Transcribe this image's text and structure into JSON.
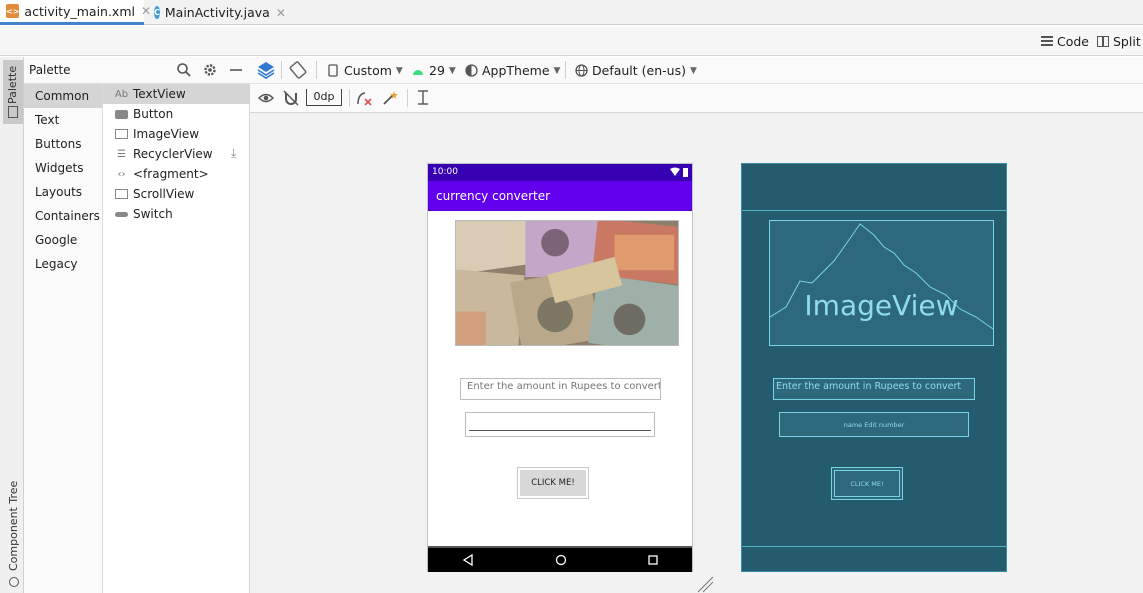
{
  "tabs": [
    {
      "label": "activity_main.xml",
      "active": true,
      "icon": "xml-file-icon"
    },
    {
      "label": "MainActivity.java",
      "active": false,
      "icon": "java-class-icon",
      "icon_letter": "C"
    }
  ],
  "view_modes": {
    "code": "Code",
    "split": "Split"
  },
  "side_tabs": {
    "palette": "Palette",
    "component_tree": "Component Tree"
  },
  "palette": {
    "title": "Palette",
    "categories": [
      "Common",
      "Text",
      "Buttons",
      "Widgets",
      "Layouts",
      "Containers",
      "Google",
      "Legacy"
    ],
    "selected_category": "Common",
    "items": [
      {
        "label": "TextView",
        "icon": "textview-icon",
        "glyph": "Ab"
      },
      {
        "label": "Button",
        "icon": "button-icon",
        "glyph": ""
      },
      {
        "label": "ImageView",
        "icon": "imageview-icon",
        "glyph": ""
      },
      {
        "label": "RecyclerView",
        "icon": "recyclerview-icon",
        "glyph": "☰"
      },
      {
        "label": "<fragment>",
        "icon": "fragment-icon",
        "glyph": "‹›"
      },
      {
        "label": "ScrollView",
        "icon": "scrollview-icon",
        "glyph": ""
      },
      {
        "label": "Switch",
        "icon": "switch-icon",
        "glyph": ""
      }
    ],
    "selected_item": "TextView"
  },
  "toolbar": {
    "device": "Custom",
    "api": "29",
    "theme": "AppTheme",
    "locale": "Default (en-us)",
    "margin": "0dp"
  },
  "phone": {
    "time": "10:00",
    "app_title": "currency converter",
    "hint_text": "Enter the amount in Rupees to convert",
    "button_label": "CLICK ME!"
  },
  "blueprint": {
    "image_label": "ImageView",
    "hint_text": "Enter the amount in Rupees to convert",
    "edit_label": "name Edit number",
    "button_label": "CLICK ME!"
  },
  "colors": {
    "status_bar": "#3700b3",
    "app_bar": "#6200ee",
    "blueprint_bg": "#245b6d",
    "blueprint_line": "#78d3e6",
    "tab_underline": "#4083c9"
  }
}
